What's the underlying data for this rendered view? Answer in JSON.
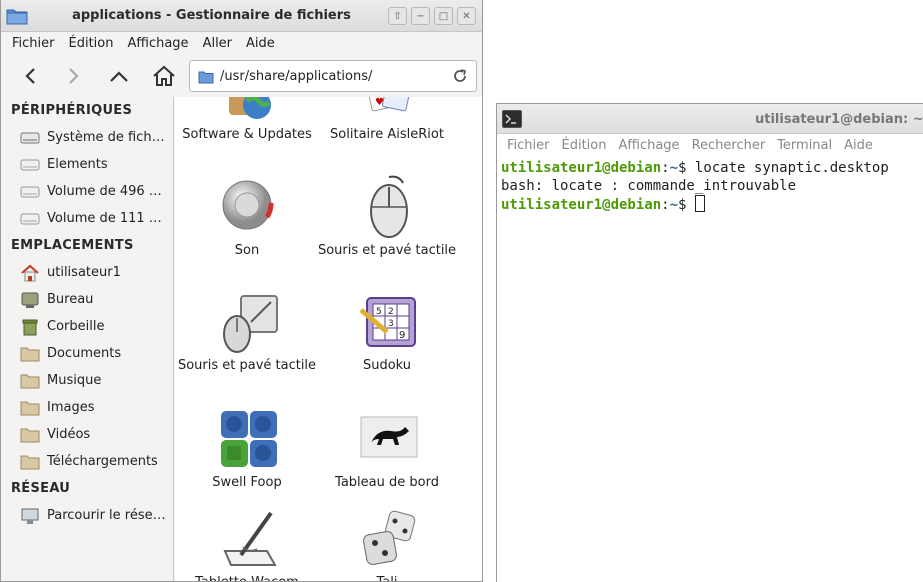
{
  "file_manager": {
    "title": "applications - Gestionnaire de fichiers",
    "window_buttons": [
      "⇧",
      "−",
      "□",
      "✕"
    ],
    "menu": [
      "Fichier",
      "Édition",
      "Affichage",
      "Aller",
      "Aide"
    ],
    "address": "/usr/share/applications/",
    "sidebar": {
      "sections": [
        {
          "title": "PÉRIPHÉRIQUES",
          "items": [
            {
              "label": "Système de fich…",
              "icon": "drive-icon"
            },
            {
              "label": "Elements",
              "icon": "drive-icon"
            },
            {
              "label": "Volume de 496 …",
              "icon": "drive-icon"
            },
            {
              "label": "Volume de 111 …",
              "icon": "drive-icon"
            }
          ]
        },
        {
          "title": "EMPLACEMENTS",
          "items": [
            {
              "label": "utilisateur1",
              "icon": "home-icon"
            },
            {
              "label": "Bureau",
              "icon": "desktop-icon"
            },
            {
              "label": "Corbeille",
              "icon": "trash-icon"
            },
            {
              "label": "Documents",
              "icon": "folder-icon"
            },
            {
              "label": "Musique",
              "icon": "folder-icon"
            },
            {
              "label": "Images",
              "icon": "folder-icon"
            },
            {
              "label": "Vidéos",
              "icon": "folder-icon"
            },
            {
              "label": "Téléchargements",
              "icon": "folder-icon"
            }
          ]
        },
        {
          "title": "RÉSEAU",
          "items": [
            {
              "label": "Parcourir le rése…",
              "icon": "network-icon"
            }
          ]
        }
      ]
    },
    "files": [
      {
        "label": "Software & Updates",
        "icon": "software-updates-icon"
      },
      {
        "label": "Solitaire AisleRiot",
        "icon": "cards-icon"
      },
      {
        "label": "Son",
        "icon": "sound-knob-icon"
      },
      {
        "label": "Souris et pavé tactile",
        "icon": "mouse-icon"
      },
      {
        "label": "Souris et pavé tactile",
        "icon": "mouse-touchpad-icon"
      },
      {
        "label": "Sudoku",
        "icon": "sudoku-icon"
      },
      {
        "label": "Swell Foop",
        "icon": "swell-foop-icon"
      },
      {
        "label": "Tableau de bord",
        "icon": "xfce-mouse-icon"
      },
      {
        "label": "Tablette Wacom",
        "icon": "wacom-tablet-icon"
      },
      {
        "label": "Tali",
        "icon": "dice-icon"
      }
    ]
  },
  "terminal": {
    "title": "utilisateur1@debian: ~",
    "menu": [
      "Fichier",
      "Édition",
      "Affichage",
      "Rechercher",
      "Terminal",
      "Aide"
    ],
    "lines": {
      "l1_user": "utilisateur1@debian",
      "l1_sep": ":",
      "l1_path": "~",
      "l1_cmd": "$ locate synaptic.desktop",
      "l2": "bash: locate : commande_introuvable",
      "l3_user": "utilisateur1@debian",
      "l3_sep": ":",
      "l3_path": "~",
      "l3_cmd": "$ "
    }
  },
  "colors": {
    "prompt_user": "#4e9a06",
    "prompt_path": "#3465a4"
  }
}
